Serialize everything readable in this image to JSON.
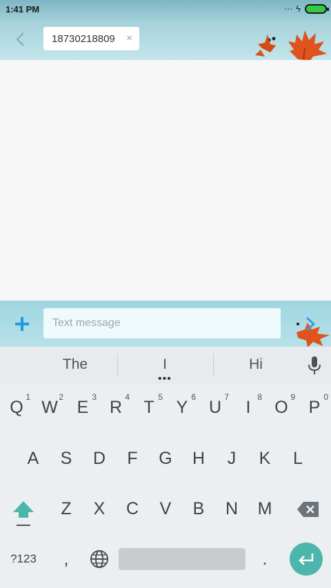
{
  "status_bar": {
    "time": "1:41 PM"
  },
  "header": {
    "recipient": "18730218809",
    "remove_symbol": "×"
  },
  "composer": {
    "placeholder": "Text message"
  },
  "keyboard": {
    "suggestions": [
      "The",
      "I",
      "Hi"
    ],
    "row1": [
      "Q",
      "W",
      "E",
      "R",
      "T",
      "Y",
      "U",
      "I",
      "O",
      "P"
    ],
    "row1_numbers": [
      "1",
      "2",
      "3",
      "4",
      "5",
      "6",
      "7",
      "8",
      "9",
      "0"
    ],
    "row2": [
      "A",
      "S",
      "D",
      "F",
      "G",
      "H",
      "J",
      "K",
      "L"
    ],
    "row3": [
      "Z",
      "X",
      "C",
      "V",
      "B",
      "N",
      "M"
    ],
    "symbols_key": "?123",
    "comma_key": ",",
    "period_key": "."
  },
  "colors": {
    "accent": "#4db6ac",
    "battery": "#37c94a",
    "plus": "#1e9be0"
  },
  "icons": [
    "back-arrow-icon",
    "close-icon",
    "plus-icon",
    "send-icon",
    "mic-icon",
    "shift-icon",
    "backspace-icon",
    "globe-icon",
    "enter-icon"
  ]
}
